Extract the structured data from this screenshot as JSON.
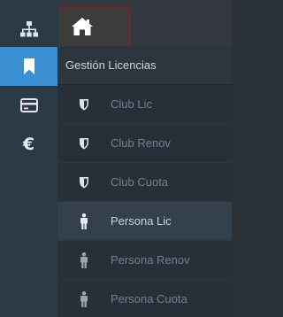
{
  "rail": {
    "items": [
      {
        "icon": "sitemap-icon",
        "active": false
      },
      {
        "icon": "bookmark-icon",
        "active": true
      },
      {
        "icon": "credit-card-icon",
        "active": false
      },
      {
        "icon": "euro-icon",
        "active": false,
        "glyph": "€"
      }
    ],
    "active_color": "#3a8fd3"
  },
  "topbar": {
    "home_icon": "home-icon"
  },
  "menu": {
    "header": "Gestión Licencias",
    "items": [
      {
        "label": "Club Lic",
        "icon": "shield-icon",
        "active": false
      },
      {
        "label": "Club Renov",
        "icon": "shield-icon",
        "active": false
      },
      {
        "label": "Club Cuota",
        "icon": "shield-icon",
        "active": false
      },
      {
        "label": "Persona Lic",
        "icon": "person-icon",
        "active": true
      },
      {
        "label": "Persona Renov",
        "icon": "person-icon",
        "active": false
      },
      {
        "label": "Persona Cuota",
        "icon": "person-icon",
        "active": false
      }
    ]
  }
}
